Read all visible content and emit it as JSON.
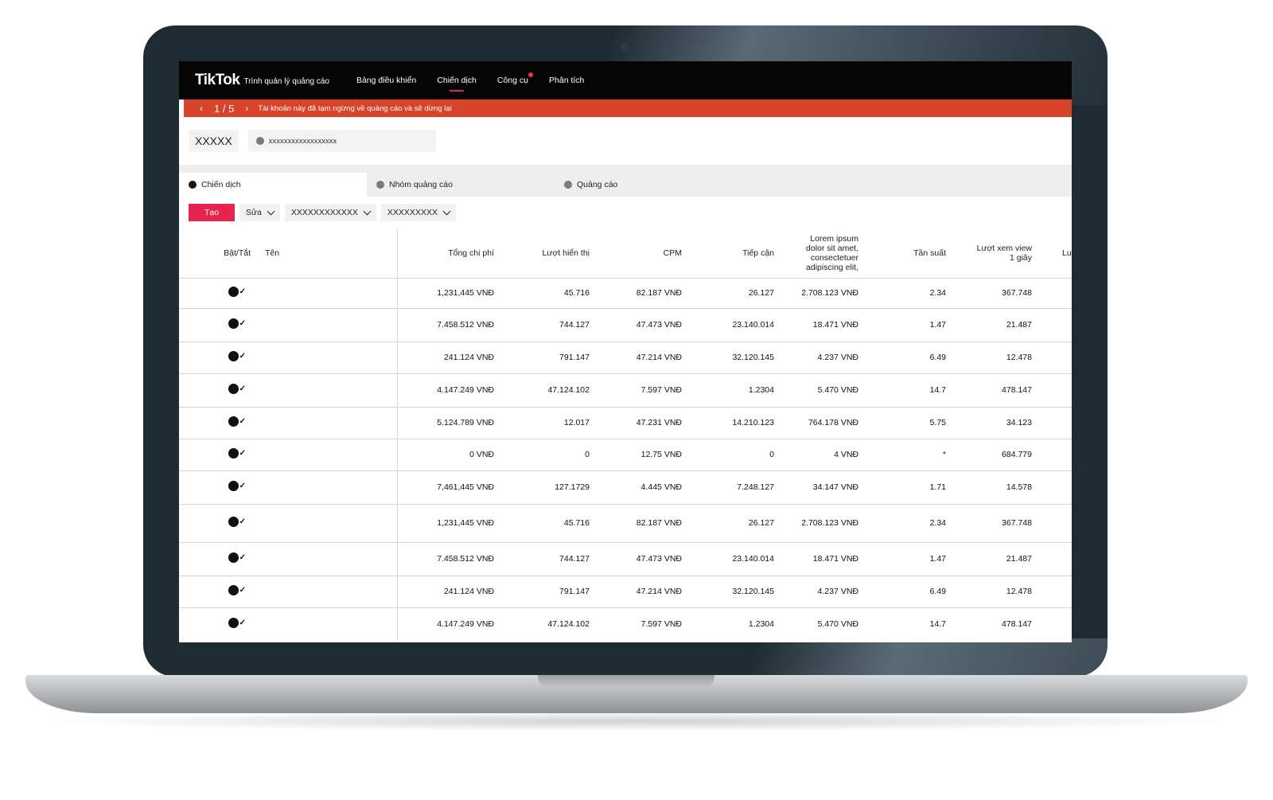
{
  "app": {
    "logo": "TikTok",
    "subtitle": "Trình quản lý quảng cáo",
    "nav": [
      "Bảng điều khiển",
      "Chiến dịch",
      "Công cụ",
      "Phân tích"
    ]
  },
  "alert": {
    "pager": "1 / 5",
    "message": "Tài khoản này đã tạm ngừng về quảng cáo và sẽ dừng lại"
  },
  "account": {
    "name": "XXXXX",
    "id": "xxxxxxxxxxxxxxxxxx"
  },
  "tabs": [
    "Chiến dịch",
    "Nhóm quảng cáo",
    "Quảng cáo"
  ],
  "toolbar": {
    "create": "Tạo",
    "edit": "Sửa",
    "filter1": "XXXXXXXXXXXX",
    "filter2": "XXXXXXXXX"
  },
  "table": {
    "headers": {
      "toggle": "Bật/Tắt",
      "name": "Tên",
      "cost": "Tổng chi phí",
      "impressions": "Lượt hiển thị",
      "cpm": "CPM",
      "reach": "Tiếp cận",
      "lorem": "Lorem ipsum dolor sit amet, consectetuer adipiscing elit,",
      "frequency": "Tần suất",
      "views": "Lượt xem view 1 giây",
      "more": "Lu"
    },
    "rows": [
      [
        "1,231,445 VNĐ",
        "45.716",
        "82.187 VNĐ",
        "26.127",
        "2.708.123 VNĐ",
        "2.34",
        "367.748"
      ],
      [
        "7.458.512 VNĐ",
        "744.127",
        "47.473 VNĐ",
        "23.140.014",
        "18.471 VNĐ",
        "1.47",
        "21.487"
      ],
      [
        "241.124 VNĐ",
        "791.147",
        "47.214 VNĐ",
        "32.120.145",
        "4.237 VNĐ",
        "6.49",
        "12.478"
      ],
      [
        "4.147.249 VNĐ",
        "47.124.102",
        "7.597 VNĐ",
        "1.2304",
        "5.470 VNĐ",
        "14.7",
        "478.147"
      ],
      [
        "5.124.789 VNĐ",
        "12.017",
        "47.231 VNĐ",
        "14.210.123",
        "764.178 VNĐ",
        "5.75",
        "34.123"
      ],
      [
        "0 VNĐ",
        "0",
        "12.75 VNĐ",
        "0",
        "4 VNĐ",
        "*",
        "684.779"
      ],
      [
        "7,461,445 VNĐ",
        "127.1729",
        "4.445 VNĐ",
        "7.248.127",
        "34.147 VNĐ",
        "1.71",
        "14.578"
      ],
      [
        "1,231,445 VNĐ",
        "45.716",
        "82.187 VNĐ",
        "26.127",
        "2.708.123 VNĐ",
        "2.34",
        "367.748"
      ],
      [
        "7.458.512 VNĐ",
        "744.127",
        "47.473 VNĐ",
        "23.140.014",
        "18.471 VNĐ",
        "1.47",
        "21.487"
      ],
      [
        "241.124 VNĐ",
        "791.147",
        "47.214 VNĐ",
        "32.120.145",
        "4.237 VNĐ",
        "6.49",
        "12.478"
      ],
      [
        "4.147.249 VNĐ",
        "47.124.102",
        "7.597 VNĐ",
        "1.2304",
        "5.470 VNĐ",
        "14.7",
        "478.147"
      ]
    ]
  }
}
